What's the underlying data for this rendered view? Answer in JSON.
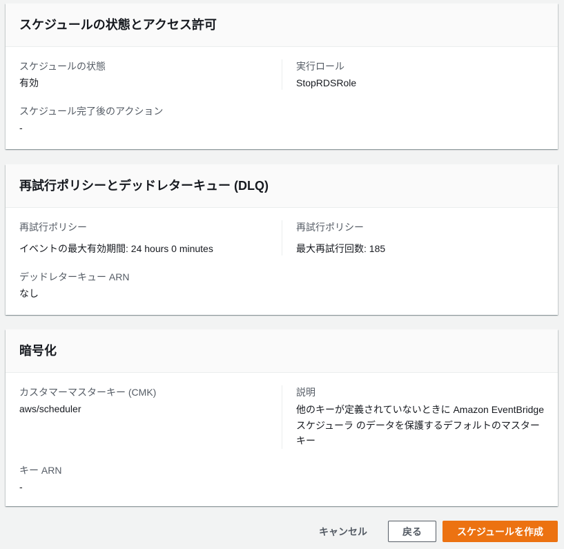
{
  "status_section": {
    "title": "スケジュールの状態とアクセス許可",
    "state_label": "スケジュールの状態",
    "state_value": "有効",
    "role_label": "実行ロール",
    "role_value": "StopRDSRole",
    "post_action_label": "スケジュール完了後のアクション",
    "post_action_value": "-"
  },
  "retry_section": {
    "title": "再試行ポリシーとデッドレターキュー (DLQ)",
    "max_age_label": "再試行ポリシー",
    "max_age_value": "イベントの最大有効期間: 24 hours 0 minutes",
    "max_retries_label": "再試行ポリシー",
    "max_retries_value": "最大再試行回数: 185",
    "dlq_label": "デッドレターキュー ARN",
    "dlq_value": "なし"
  },
  "encryption_section": {
    "title": "暗号化",
    "cmk_label": "カスタマーマスターキー (CMK)",
    "cmk_value": "aws/scheduler",
    "description_label": "説明",
    "description_value": "他のキーが定義されていないときに Amazon EventBridge スケジューラ のデータを保護するデフォルトのマスターキー",
    "key_arn_label": "キー ARN",
    "key_arn_value": "-"
  },
  "footer": {
    "cancel_label": "キャンセル",
    "back_label": "戻る",
    "create_label": "スケジュールを作成"
  },
  "colors": {
    "page_bg": "#f2f3f3",
    "primary": "#ec7211",
    "label": "#545b64",
    "text": "#16191f",
    "divider": "#eaeded",
    "header_bg": "#fafafa"
  }
}
